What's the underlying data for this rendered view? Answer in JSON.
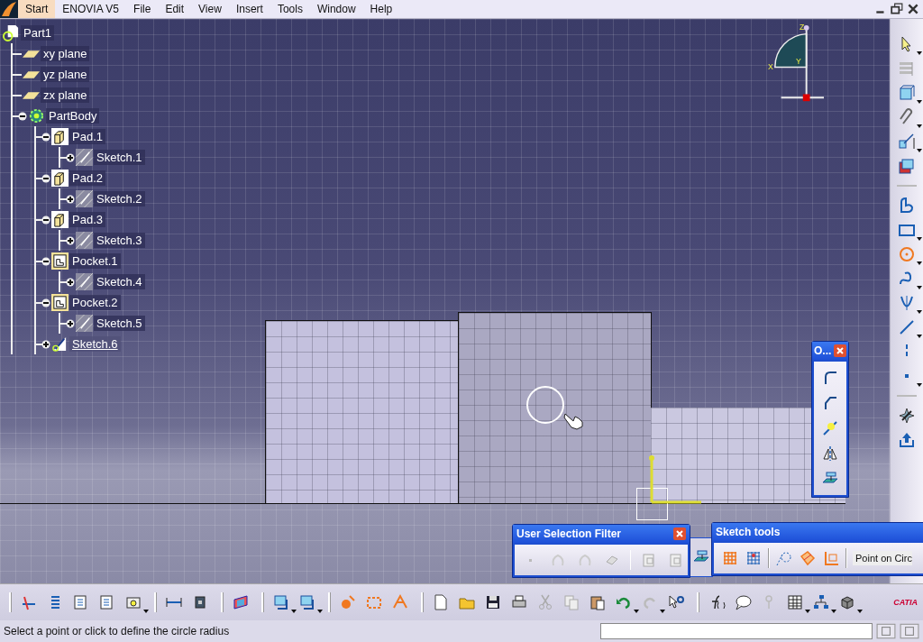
{
  "menu_bar": {
    "items": [
      {
        "label": "Start",
        "selected": true
      },
      {
        "label": "ENOVIA V5",
        "selected": false
      },
      {
        "label": "File",
        "selected": false
      },
      {
        "label": "Edit",
        "selected": false
      },
      {
        "label": "View",
        "selected": false
      },
      {
        "label": "Insert",
        "selected": false
      },
      {
        "label": "Tools",
        "selected": false
      },
      {
        "label": "Window",
        "selected": false
      },
      {
        "label": "Help",
        "selected": false
      }
    ]
  },
  "tree": {
    "label": "Part1",
    "kind": "part",
    "children": [
      {
        "label": "xy plane",
        "kind": "plane"
      },
      {
        "label": "yz plane",
        "kind": "plane"
      },
      {
        "label": "zx plane",
        "kind": "plane"
      },
      {
        "label": "PartBody",
        "kind": "body",
        "expanded": true,
        "children": [
          {
            "label": "Pad.1",
            "kind": "pad",
            "expanded": true,
            "current": false,
            "children": [
              {
                "label": "Sketch.1",
                "kind": "sketch",
                "expanded": false
              }
            ]
          },
          {
            "label": "Pad.2",
            "kind": "pad",
            "expanded": true,
            "current": false,
            "children": [
              {
                "label": "Sketch.2",
                "kind": "sketch",
                "expanded": false
              }
            ]
          },
          {
            "label": "Pad.3",
            "kind": "pad",
            "expanded": true,
            "current": false,
            "children": [
              {
                "label": "Sketch.3",
                "kind": "sketch",
                "expanded": false
              }
            ]
          },
          {
            "label": "Pocket.1",
            "kind": "pocket",
            "expanded": true,
            "current": false,
            "children": [
              {
                "label": "Sketch.4",
                "kind": "sketch",
                "expanded": false
              }
            ]
          },
          {
            "label": "Pocket.2",
            "kind": "pocket",
            "expanded": true,
            "current": false,
            "children": [
              {
                "label": "Sketch.5",
                "kind": "sketch",
                "expanded": false
              }
            ]
          },
          {
            "label": "Sketch.6",
            "kind": "sketch",
            "expanded": false,
            "current": true
          }
        ]
      }
    ]
  },
  "compass": {
    "z": "Z",
    "x": "X",
    "y": "Y"
  },
  "floating_toolbars": [
    {
      "title": "O..."
    },
    {
      "title": "User Selection Filter"
    },
    {
      "title": "Sketch tools",
      "field": "Point on Circ"
    }
  ],
  "brand_logo": "CATIA",
  "status_bar": {
    "message": "Select a point or click to define the circle radius"
  }
}
